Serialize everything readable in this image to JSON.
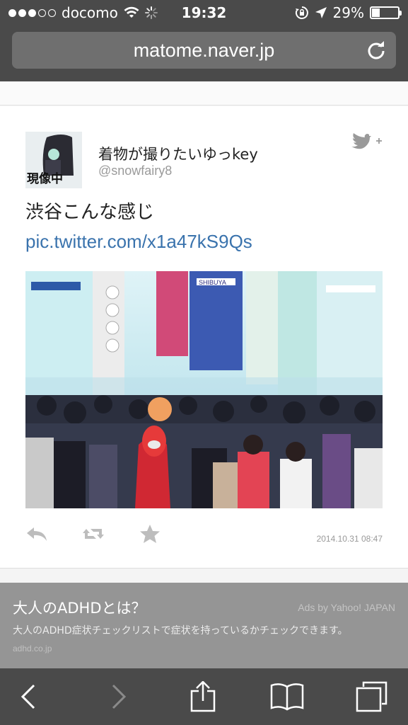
{
  "status_bar": {
    "carrier": "docomo",
    "time": "19:32",
    "battery_text": "29%",
    "battery_level": 0.29,
    "signal_bars_filled": 3,
    "signal_bars_total": 5,
    "icons": [
      "wifi-icon",
      "loading-spinner-icon",
      "rotation-lock-icon",
      "location-arrow-icon",
      "battery-icon"
    ]
  },
  "browser": {
    "url": "matome.naver.jp",
    "reload_icon": "reload-icon"
  },
  "tweet": {
    "user_name": "着物が撮りたいゆっkey",
    "user_handle": "@snowfairy8",
    "avatar_caption": "現像中",
    "text": "渋谷こんな感じ ",
    "link": "pic.twitter.com/x1a47kS9Qs",
    "timestamp": "2014.10.31 08:47",
    "photo_sign": "SHIBUYA",
    "follow_icon": "twitter-bird-plus-icon",
    "actions": [
      {
        "name": "reply-button",
        "icon": "reply-icon"
      },
      {
        "name": "retweet-button",
        "icon": "retweet-icon"
      },
      {
        "name": "favorite-button",
        "icon": "star-icon"
      }
    ]
  },
  "ad": {
    "title": "大人のADHDとは？",
    "sponsor": "Ads by Yahoo! JAPAN",
    "description": "大人のADHD症状チェックリストで症状を持っているかチェックできます。",
    "domain": "adhd.co.jp"
  },
  "toolbar": {
    "buttons": [
      "back-icon",
      "forward-icon",
      "share-icon",
      "bookmarks-icon",
      "tabs-icon"
    ]
  }
}
